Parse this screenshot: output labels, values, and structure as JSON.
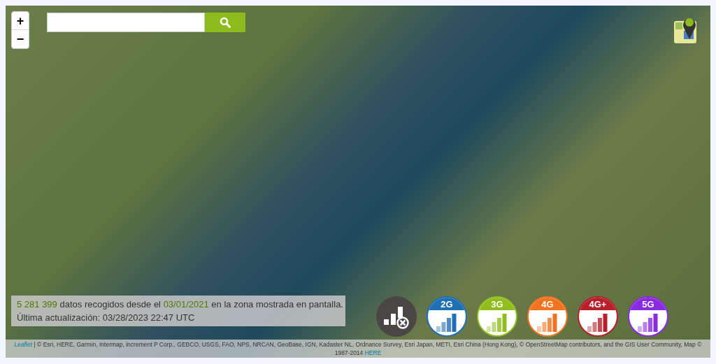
{
  "zoom_controls": [
    "+",
    "−"
  ],
  "info": {
    "count": "5 281 399",
    "text_before_date": "datos recogidos desde el",
    "date": "03/01/2021",
    "text_after_date": "en la zona mostrada en pantalla.",
    "updated": "Última actualización: 03/28/2023 22:47 UTC"
  },
  "layers": [
    {
      "kind": "none",
      "color": "#4a4645"
    },
    {
      "kind": "network",
      "label": "2G",
      "color": "#1f6fb5"
    },
    {
      "kind": "network",
      "label": "3G",
      "color": "#8fbe1e"
    },
    {
      "kind": "network",
      "label": "4G",
      "color": "#f47320"
    },
    {
      "kind": "network",
      "label": "4G+",
      "color": "#b81f2a"
    },
    {
      "kind": "network",
      "label": "5G",
      "color": "#8a2be2"
    }
  ],
  "attribution": {
    "link": "Leaflet",
    "text": "| © Esri, HERE, Garmin, Intermap, increment P Corp., GEBCO, USGS, FAO, NPS, NRCAN, GeoBase, IGN, Kadaster NL, Ordnance Survey, Esri Japan, METI, Esri China (Hong Kong), © OpenStreetMap contributors, and the GIS User Community, Map © 1987-2014",
    "link_end": "HERE"
  }
}
